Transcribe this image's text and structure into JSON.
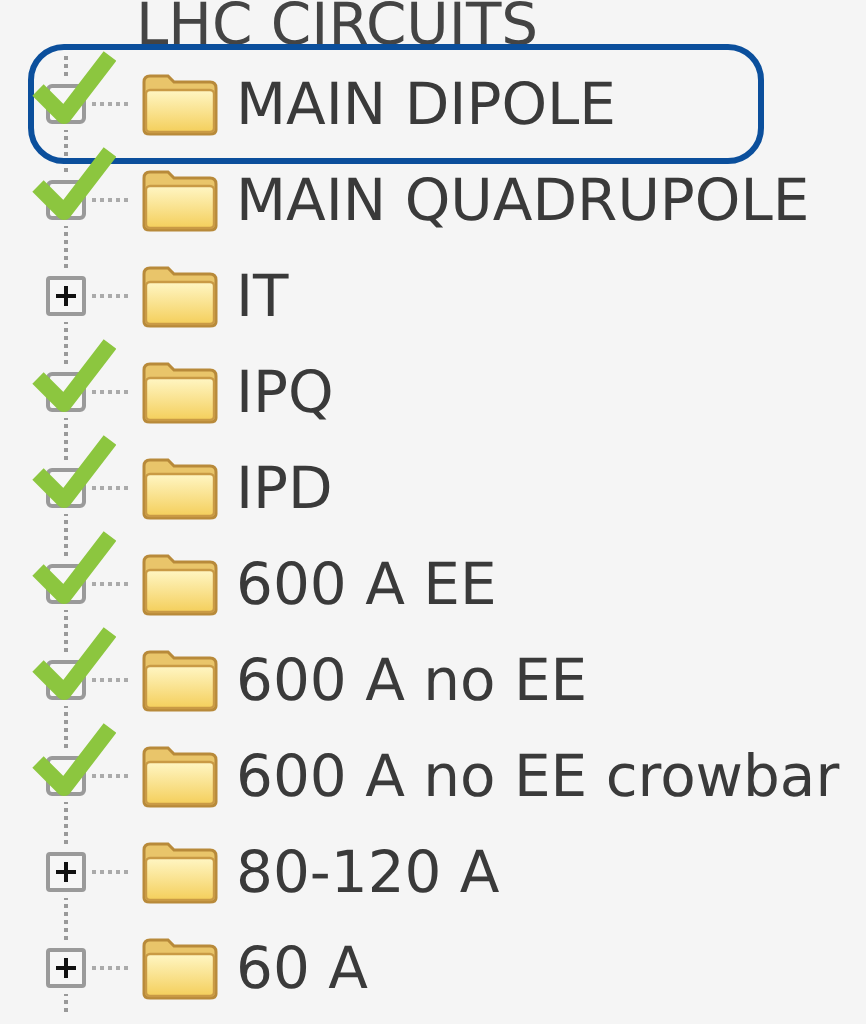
{
  "root": {
    "label": "LHC CIRCUITS"
  },
  "items": [
    {
      "label": "MAIN DIPOLE",
      "checked": true,
      "selected": true
    },
    {
      "label": "MAIN QUADRUPOLE",
      "checked": true,
      "selected": false
    },
    {
      "label": "IT",
      "checked": false,
      "selected": false
    },
    {
      "label": "IPQ",
      "checked": true,
      "selected": false
    },
    {
      "label": "IPD",
      "checked": true,
      "selected": false
    },
    {
      "label": "600 A EE",
      "checked": true,
      "selected": false
    },
    {
      "label": "600 A no EE",
      "checked": true,
      "selected": false
    },
    {
      "label": "600 A no EE crowbar",
      "checked": true,
      "selected": false
    },
    {
      "label": "80-120 A",
      "checked": false,
      "selected": false
    },
    {
      "label": "60 A",
      "checked": false,
      "selected": false
    }
  ]
}
